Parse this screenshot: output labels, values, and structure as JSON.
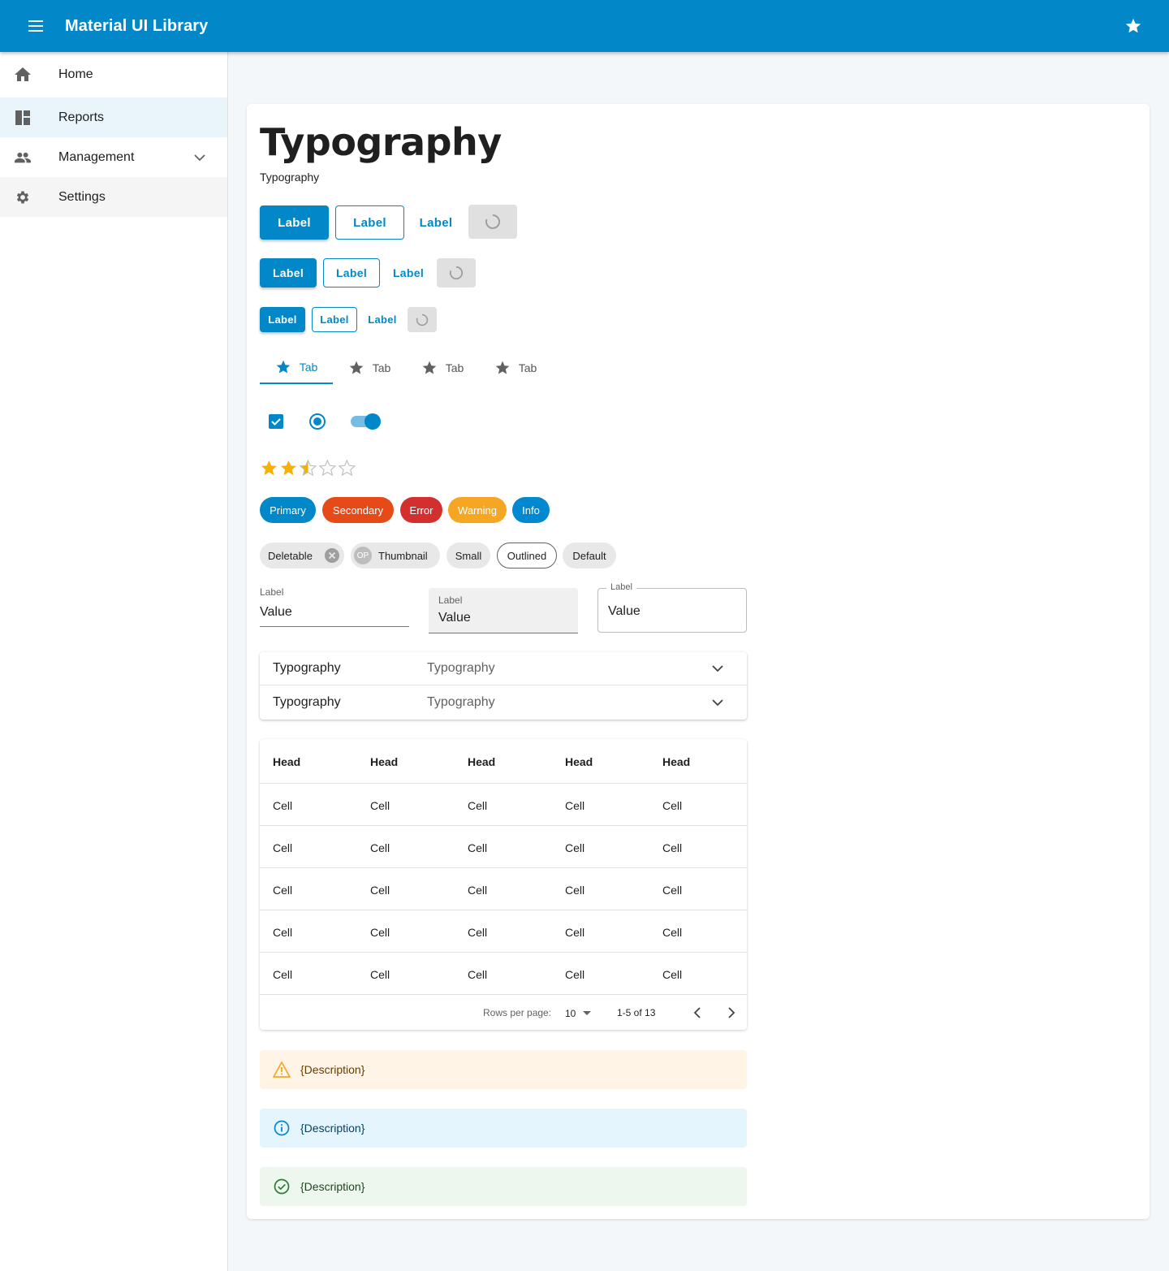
{
  "appbar": {
    "title": "Material UI Library",
    "menu_icon": "menu-icon",
    "action_icon": "star-icon"
  },
  "sidebar": {
    "items": [
      {
        "label": "Home",
        "icon": "home-icon"
      },
      {
        "label": "Reports",
        "icon": "dashboard-icon"
      },
      {
        "label": "Management",
        "icon": "people-icon"
      },
      {
        "label": "Settings",
        "icon": "gear-icon"
      }
    ]
  },
  "main": {
    "heading": "Typography",
    "subtitle": "Typography",
    "buttons": {
      "large": [
        "Label",
        "Label",
        "Label"
      ],
      "medium": [
        "Label",
        "Label",
        "Label"
      ],
      "small": [
        "Label",
        "Label",
        "Label"
      ]
    },
    "tabs": [
      "Tab",
      "Tab",
      "Tab",
      "Tab"
    ],
    "controls": {
      "checkbox_checked": true,
      "radio_checked": true,
      "switch_on": true
    },
    "rating": {
      "value": 2.5,
      "max": 5
    },
    "color_chips": [
      "Primary",
      "Secondary",
      "Error",
      "Warning",
      "Info"
    ],
    "chips": {
      "deletable": "Deletable",
      "thumbnail_avatar": "OP",
      "thumbnail": "Thumbnail",
      "small": "Small",
      "outlined": "Outlined",
      "default": "Default"
    },
    "inputs": [
      {
        "variant": "standard",
        "label": "Label",
        "value": "Value"
      },
      {
        "variant": "filled",
        "label": "Label",
        "value": "Value"
      },
      {
        "variant": "outlined",
        "label": "Label",
        "value": "Value"
      }
    ],
    "accordion": [
      {
        "title": "Typography",
        "secondary": "Typography"
      },
      {
        "title": "Typography",
        "secondary": "Typography"
      }
    ],
    "table": {
      "headers": [
        "Head",
        "Head",
        "Head",
        "Head",
        "Head"
      ],
      "rows": [
        [
          "Cell",
          "Cell",
          "Cell",
          "Cell",
          "Cell"
        ],
        [
          "Cell",
          "Cell",
          "Cell",
          "Cell",
          "Cell"
        ],
        [
          "Cell",
          "Cell",
          "Cell",
          "Cell",
          "Cell"
        ],
        [
          "Cell",
          "Cell",
          "Cell",
          "Cell",
          "Cell"
        ],
        [
          "Cell",
          "Cell",
          "Cell",
          "Cell",
          "Cell"
        ]
      ],
      "pagination": {
        "rows_per_page_label": "Rows per page:",
        "rows_per_page": "10",
        "range": "1-5 of 13"
      }
    },
    "alerts": [
      {
        "severity": "warning",
        "text": "{Description}"
      },
      {
        "severity": "info",
        "text": "{Description}"
      },
      {
        "severity": "success",
        "text": "{Description}"
      }
    ]
  },
  "colors": {
    "primary": "#0288c8",
    "secondary": "#e64a19",
    "error": "#d32f2f",
    "warning": "#f5a623",
    "info": "#0288d1",
    "rating": "#faaf00"
  }
}
